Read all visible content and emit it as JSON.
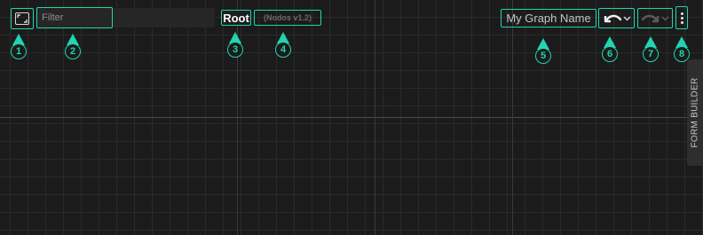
{
  "toolbar": {
    "filter_placeholder": "Filter",
    "breadcrumb_root": "Root",
    "version": "(Nodos v1.2)",
    "graph_name": "My Graph Name"
  },
  "side_panel": {
    "label": "FORM BUILDER"
  },
  "callouts": [
    "1",
    "2",
    "3",
    "4",
    "5",
    "6",
    "7",
    "8"
  ],
  "colors": {
    "accent": "#22d4b0",
    "background": "#1b1b1b"
  },
  "icons": [
    "expand-icon",
    "undo-icon",
    "redo-icon",
    "chevron-down-icon",
    "more-vertical-icon"
  ]
}
